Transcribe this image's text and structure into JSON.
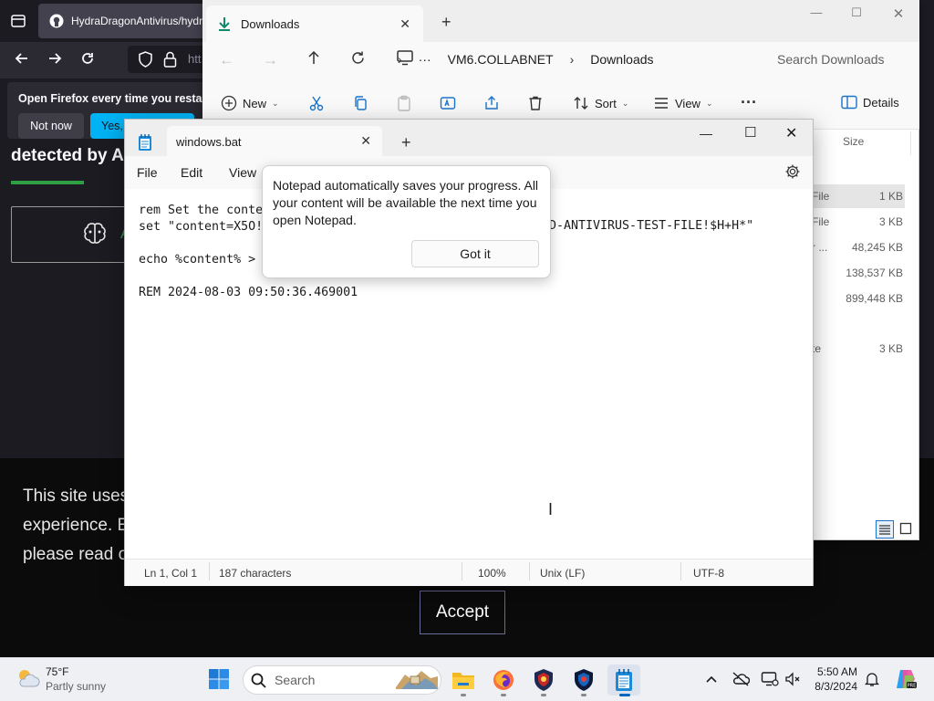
{
  "firefox": {
    "tab_title": "HydraDragonAntivirus/hydr",
    "url_partial": "htt",
    "banner_text": "Open Firefox every time you restart",
    "not_now_label": "Not now",
    "yes_label": "Yes, c",
    "page_heading": "detected by A",
    "card_letter": "A",
    "cookie_lines": [
      "This site uses",
      "experience. E",
      "please read o"
    ],
    "accept_label": "Accept"
  },
  "explorer": {
    "tab_title": "Downloads",
    "path": [
      "VM6.COLLABNET",
      "Downloads"
    ],
    "path_overflow": "···",
    "search_placeholder": "Search Downloads",
    "toolbar": {
      "new_label": "New",
      "sort_label": "Sort",
      "view_label": "View",
      "details_label": "Details"
    },
    "size_header": "Size",
    "rows": [
      {
        "type": "File",
        "size": "1 KB"
      },
      {
        "type": "File",
        "size": "3 KB"
      },
      {
        "type": "r ...",
        "size": "48,245 KB"
      },
      {
        "type": "",
        "size": "138,537 KB"
      },
      {
        "type": "",
        "size": "899,448 KB"
      },
      {
        "type": "",
        "size": ""
      },
      {
        "type": "te",
        "size": "3 KB"
      }
    ]
  },
  "notepad": {
    "tab_title": "windows.bat",
    "menu": [
      "File",
      "Edit",
      "View"
    ],
    "lines": [
      "rem Set the conte",
      "set \"content=X5O!",
      "",
      "echo %content% >",
      "",
      "REM 2024-08-03 09:50:36.469001"
    ],
    "line2_tail": "D-ANTIVIRUS-TEST-FILE!$H+H*\"",
    "popup_text": "Notepad automatically saves your progress. All your content will be available the next time you open Notepad.",
    "popup_button": "Got it",
    "status": {
      "position": "Ln 1, Col 1",
      "chars": "187 characters",
      "zoom": "100%",
      "line_ending": "Unix (LF)",
      "encoding": "UTF-8"
    }
  },
  "taskbar": {
    "weather_temp": "75°F",
    "weather_desc": "Partly sunny",
    "search_placeholder": "Search",
    "time": "5:50 AM",
    "date": "8/3/2024"
  },
  "colors": {
    "firefox_bg": "#1c1b22",
    "firefox_accent": "#00b3f4",
    "github_green": "#2ea043",
    "explorer_bg": "#ffffff",
    "taskbar_bg": "#eef0f4",
    "notepad_accent": "#0067c0"
  }
}
